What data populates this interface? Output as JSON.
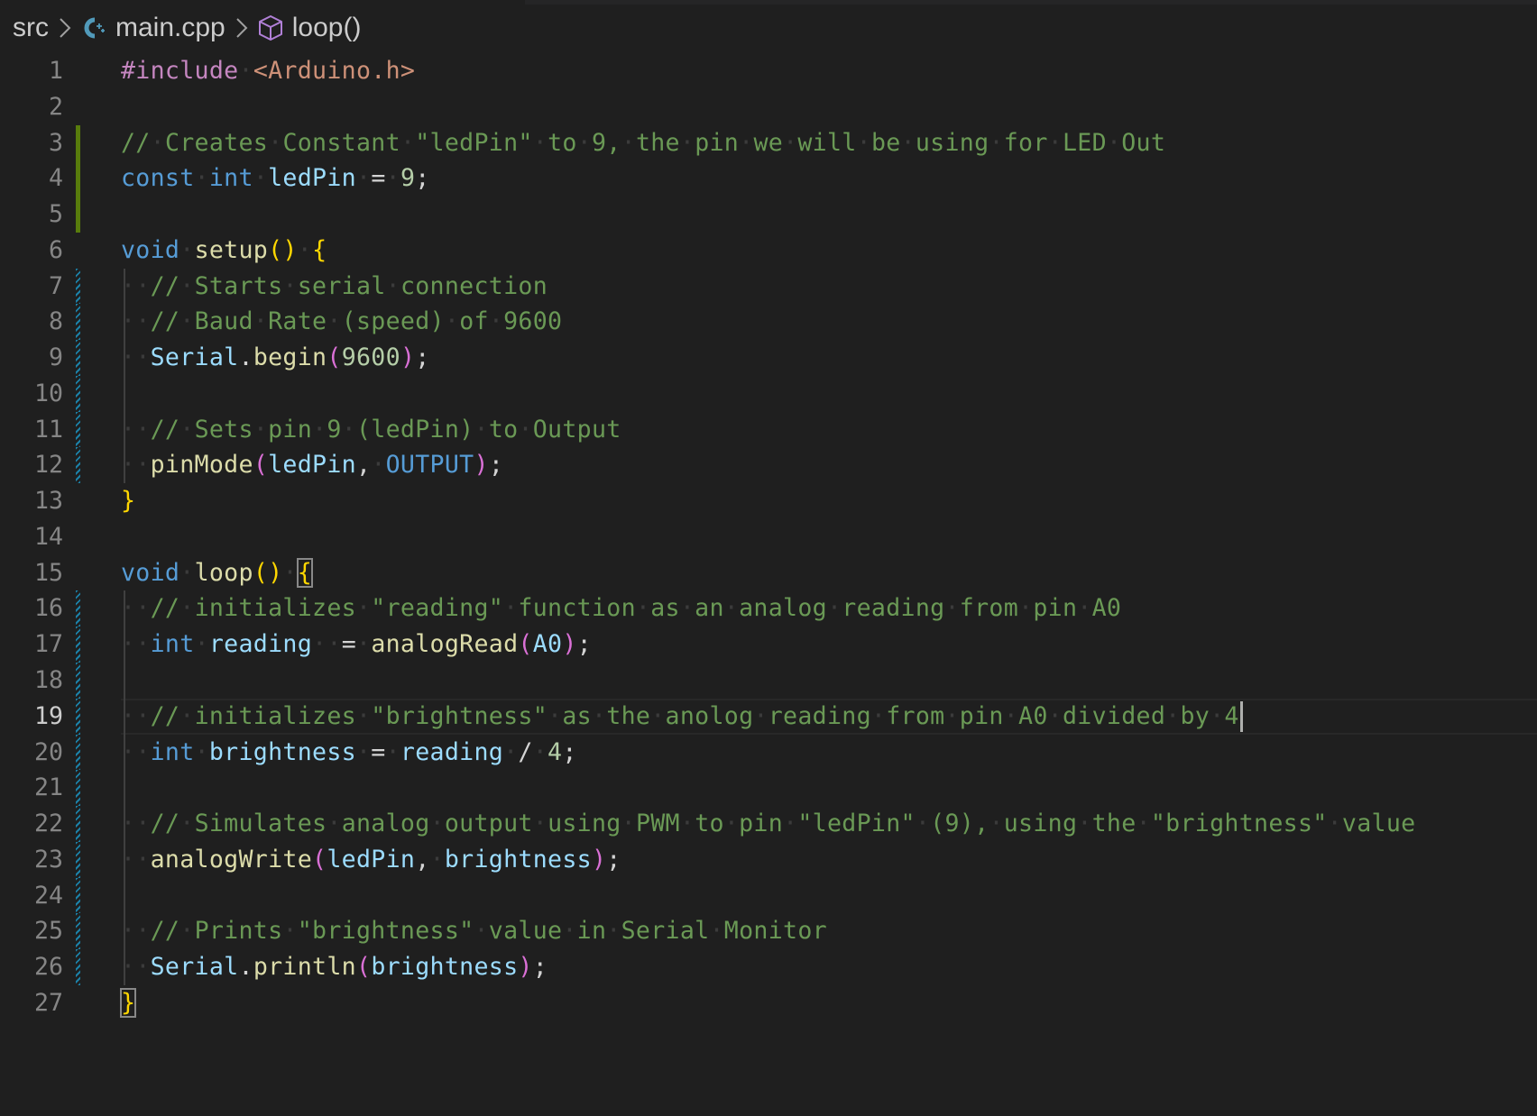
{
  "breadcrumb": {
    "items": [
      {
        "label": "src",
        "icon": null
      },
      {
        "label": "main.cpp",
        "icon": "cpp-file-icon"
      },
      {
        "label": "loop()",
        "icon": "method-cube-icon"
      }
    ],
    "separator": "chevron-right-icon"
  },
  "editor": {
    "language": "cpp",
    "cursor": {
      "line": 19,
      "after_text": "// initializes \"brightness\" as the anolog reading from pin A0 divided by 4"
    },
    "active_line": 19,
    "matched_brackets": [
      {
        "line": 15,
        "char": "{"
      },
      {
        "line": 27,
        "char": "}"
      }
    ],
    "colors": {
      "background": "#1f1f1f",
      "comment": "#6a9955",
      "keyword": "#569cd6",
      "function": "#dcdcaa",
      "variable": "#9cdcfe",
      "number": "#b5cea8",
      "string": "#ce9178",
      "preprocessor": "#c586c0",
      "bracket_level1": "#ffd700",
      "bracket_level2": "#da70d6",
      "git_added": "#587c0c",
      "git_modified": "#1b81a8"
    },
    "lines": [
      {
        "n": "1",
        "git": null,
        "text": "#include <Arduino.h>"
      },
      {
        "n": "2",
        "git": null,
        "text": ""
      },
      {
        "n": "3",
        "git": "added",
        "text": "// Creates Constant \"ledPin\" to 9, the pin we will be using for LED Out"
      },
      {
        "n": "4",
        "git": "added",
        "text": "const int ledPin = 9;"
      },
      {
        "n": "5",
        "git": "added",
        "text": ""
      },
      {
        "n": "6",
        "git": null,
        "text": "void setup() {"
      },
      {
        "n": "7",
        "git": "modified",
        "text": "  // Starts serial connection"
      },
      {
        "n": "8",
        "git": "modified",
        "text": "  // Baud Rate (speed) of 9600"
      },
      {
        "n": "9",
        "git": "modified",
        "text": "  Serial.begin(9600);"
      },
      {
        "n": "10",
        "git": "modified",
        "text": ""
      },
      {
        "n": "11",
        "git": "modified",
        "text": "  // Sets pin 9 (ledPin) to Output"
      },
      {
        "n": "12",
        "git": "modified",
        "text": "  pinMode(ledPin, OUTPUT);"
      },
      {
        "n": "13",
        "git": null,
        "text": "}"
      },
      {
        "n": "14",
        "git": null,
        "text": ""
      },
      {
        "n": "15",
        "git": null,
        "text": "void loop() {"
      },
      {
        "n": "16",
        "git": "modified",
        "text": "  // initializes \"reading\" function as an analog reading from pin A0"
      },
      {
        "n": "17",
        "git": "modified",
        "text": "  int reading  = analogRead(A0);"
      },
      {
        "n": "18",
        "git": "modified",
        "text": ""
      },
      {
        "n": "19",
        "git": "modified",
        "text": "  // initializes \"brightness\" as the anolog reading from pin A0 divided by 4"
      },
      {
        "n": "20",
        "git": "modified",
        "text": "  int brightness = reading / 4;"
      },
      {
        "n": "21",
        "git": "modified",
        "text": ""
      },
      {
        "n": "22",
        "git": "modified",
        "text": "  // Simulates analog output using PWM to pin \"ledPin\" (9), using the \"brightness\" value"
      },
      {
        "n": "23",
        "git": "modified",
        "text": "  analogWrite(ledPin, brightness);"
      },
      {
        "n": "24",
        "git": "modified",
        "text": ""
      },
      {
        "n": "25",
        "git": "modified",
        "text": "  // Prints \"brightness\" value in Serial Monitor"
      },
      {
        "n": "26",
        "git": "modified",
        "text": "  Serial.println(brightness);"
      },
      {
        "n": "27",
        "git": null,
        "text": "}"
      }
    ],
    "tokens": {
      "l1": [
        "#include",
        "<Arduino.h>"
      ],
      "l3": "// Creates Constant \"ledPin\" to 9, the pin we will be using for LED Out",
      "l4": [
        "const",
        "int",
        "ledPin",
        "=",
        "9",
        ";"
      ],
      "l6": [
        "void",
        "setup",
        "(",
        ")",
        "{"
      ],
      "l7": "// Starts serial connection",
      "l8": "// Baud Rate (speed) of 9600",
      "l9": [
        "Serial",
        ".",
        "begin",
        "(",
        "9600",
        ")",
        ";"
      ],
      "l11": "// Sets pin 9 (ledPin) to Output",
      "l12": [
        "pinMode",
        "(",
        "ledPin",
        ",",
        "OUTPUT",
        ")",
        ";"
      ],
      "l13": "}",
      "l15": [
        "void",
        "loop",
        "(",
        ")",
        "{"
      ],
      "l16": "// initializes \"reading\" function as an analog reading from pin A0",
      "l17": [
        "int",
        "reading",
        "=",
        "analogRead",
        "(",
        "A0",
        ")",
        ";"
      ],
      "l19": "// initializes \"brightness\" as the anolog reading from pin A0 divided by 4",
      "l20": [
        "int",
        "brightness",
        "=",
        "reading",
        "/",
        "4",
        ";"
      ],
      "l22": "// Simulates analog output using PWM to pin \"ledPin\" (9), using the \"brightness\" value",
      "l23": [
        "analogWrite",
        "(",
        "ledPin",
        ",",
        "brightness",
        ")",
        ";"
      ],
      "l25": "// Prints \"brightness\" value in Serial Monitor",
      "l26": [
        "Serial",
        ".",
        "println",
        "(",
        "brightness",
        ")",
        ";"
      ],
      "l27": "}"
    }
  }
}
